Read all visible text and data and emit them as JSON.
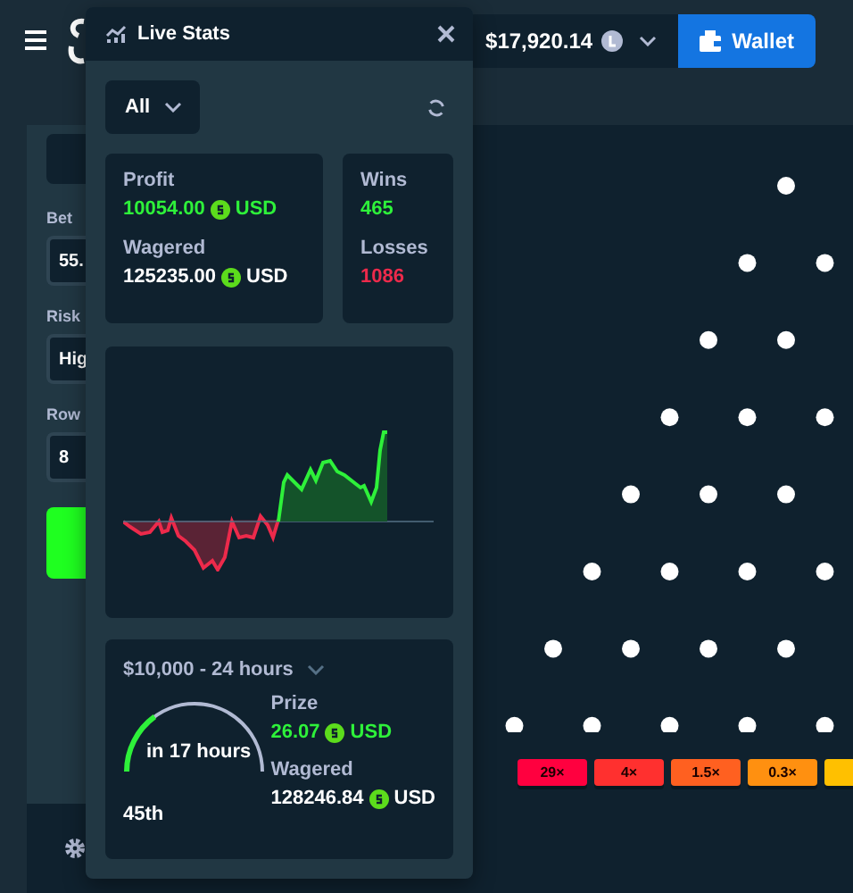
{
  "topbar": {
    "balance": "$17,920.14",
    "wallet_button": "Wallet"
  },
  "sidebar": {
    "fields": [
      {
        "label": "Bet",
        "value": "55."
      },
      {
        "label": "Risk",
        "value": "Hig"
      },
      {
        "label": "Row",
        "value": "8"
      }
    ]
  },
  "multipliers": [
    {
      "label": "29×",
      "color": "#ff003f"
    },
    {
      "label": "4×",
      "color": "#ff302f"
    },
    {
      "label": "1.5×",
      "color": "#ff6020"
    },
    {
      "label": "0.3×",
      "color": "#ff9010"
    },
    {
      "color": "#ffc000"
    }
  ],
  "live_stats": {
    "title": "Live Stats",
    "filter": "All",
    "profit_label": "Profit",
    "profit": "10054.00",
    "profit_currency": "USD",
    "wagered_label": "Wagered",
    "wagered": "125235.00",
    "wagered_currency": "USD",
    "wins_label": "Wins",
    "wins": "465",
    "losses_label": "Losses",
    "losses": "1086",
    "race": {
      "title": "$10,000 - 24 hours",
      "time_left": "in 17 hours",
      "rank": "45th",
      "prize_label": "Prize",
      "prize": "26.07",
      "prize_currency": "USD",
      "wagered_label": "Wagered",
      "wagered": "128246.84",
      "wagered_currency": "USD"
    }
  }
}
